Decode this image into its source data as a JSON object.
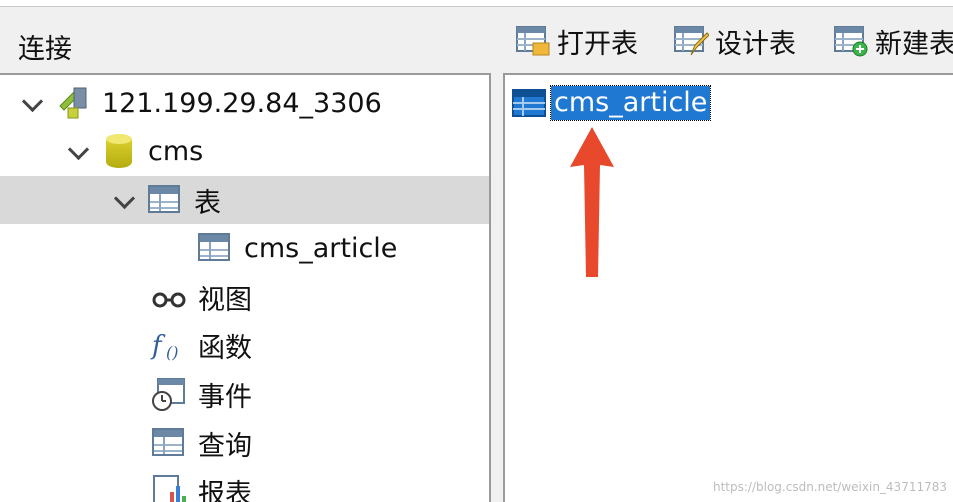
{
  "left_header": {
    "title": "连接"
  },
  "toolbar": {
    "open_table": "打开表",
    "design_table": "设计表",
    "new_table": "新建表"
  },
  "tree": {
    "connection": "121.199.29.84_3306",
    "database": "cms",
    "tables_group": "表",
    "table_item": "cms_article",
    "views": "视图",
    "functions": "函数",
    "events": "事件",
    "queries": "查询",
    "reports": "报表"
  },
  "objects": {
    "items": [
      "cms_article"
    ]
  },
  "watermark": "https://blog.csdn.net/weixin_43711783",
  "colors": {
    "selection_blue": "#1f78d1",
    "arrow_red": "#e8492c",
    "selected_row_gray": "#d9d9d9"
  }
}
